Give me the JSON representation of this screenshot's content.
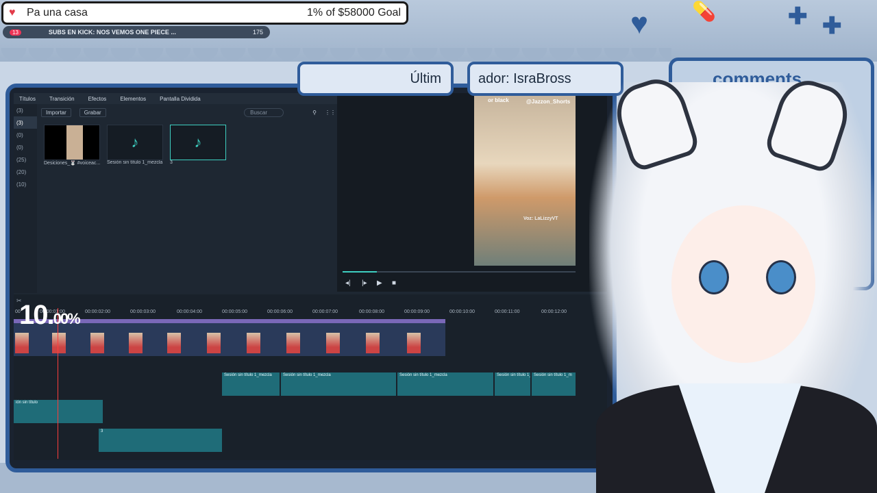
{
  "goal": {
    "title": "Pa una casa",
    "progress_text": "1% of $58000 Goal",
    "progress_fraction": 0.01
  },
  "ticker": {
    "badge": "13",
    "message": "SUBS EN KICK: NOS VEMOS ONE PIECE ...",
    "count": "175"
  },
  "username_bubbles": {
    "left": "Últim",
    "right": "ador: IsraBross"
  },
  "comments_title": "comments",
  "editor": {
    "menu": [
      "Títulos",
      "Transición",
      "Efectos",
      "Elementos",
      "Pantalla Dividida"
    ],
    "sidebar": [
      "(3)",
      "(3)",
      "(0)",
      "(0)",
      "(25)",
      "(20)",
      "(10)"
    ],
    "toolbar": {
      "import_label": "Importar",
      "record_label": "Grabar",
      "search_placeholder": "Buscar"
    },
    "media": [
      {
        "label": "Desiciones_🐰 #voiceac..."
      },
      {
        "label": "Sesión sin título 1_mezcla"
      },
      {
        "label": "3"
      }
    ],
    "preview": {
      "handle": "@Jazzon_Shorts",
      "watermark": "Voz: LaLizzyVT",
      "caption_top": "or black"
    },
    "ruler": [
      "00",
      "00:00:01:00",
      "00:00:02:00",
      "00:00:03:00",
      "00:00:04:00",
      "00:00:05:00",
      "00:00:06:00",
      "00:00:07:00",
      "00:00:08:00",
      "00:00:09:00",
      "00:00:10:00",
      "00:00:11:00",
      "00:00:12:00"
    ],
    "audio_labels": [
      "Sesión sin título 1_mezcla",
      "Sesión sin título 1_mezcla",
      "Sesión sin título 1_mezcla",
      "Sesión sin título 1_mezcla",
      "Sesión sin título 1_m"
    ],
    "audio2_label": "3",
    "lower_label": "ión sin título",
    "percent_main": "10.",
    "percent_small": "00%"
  }
}
